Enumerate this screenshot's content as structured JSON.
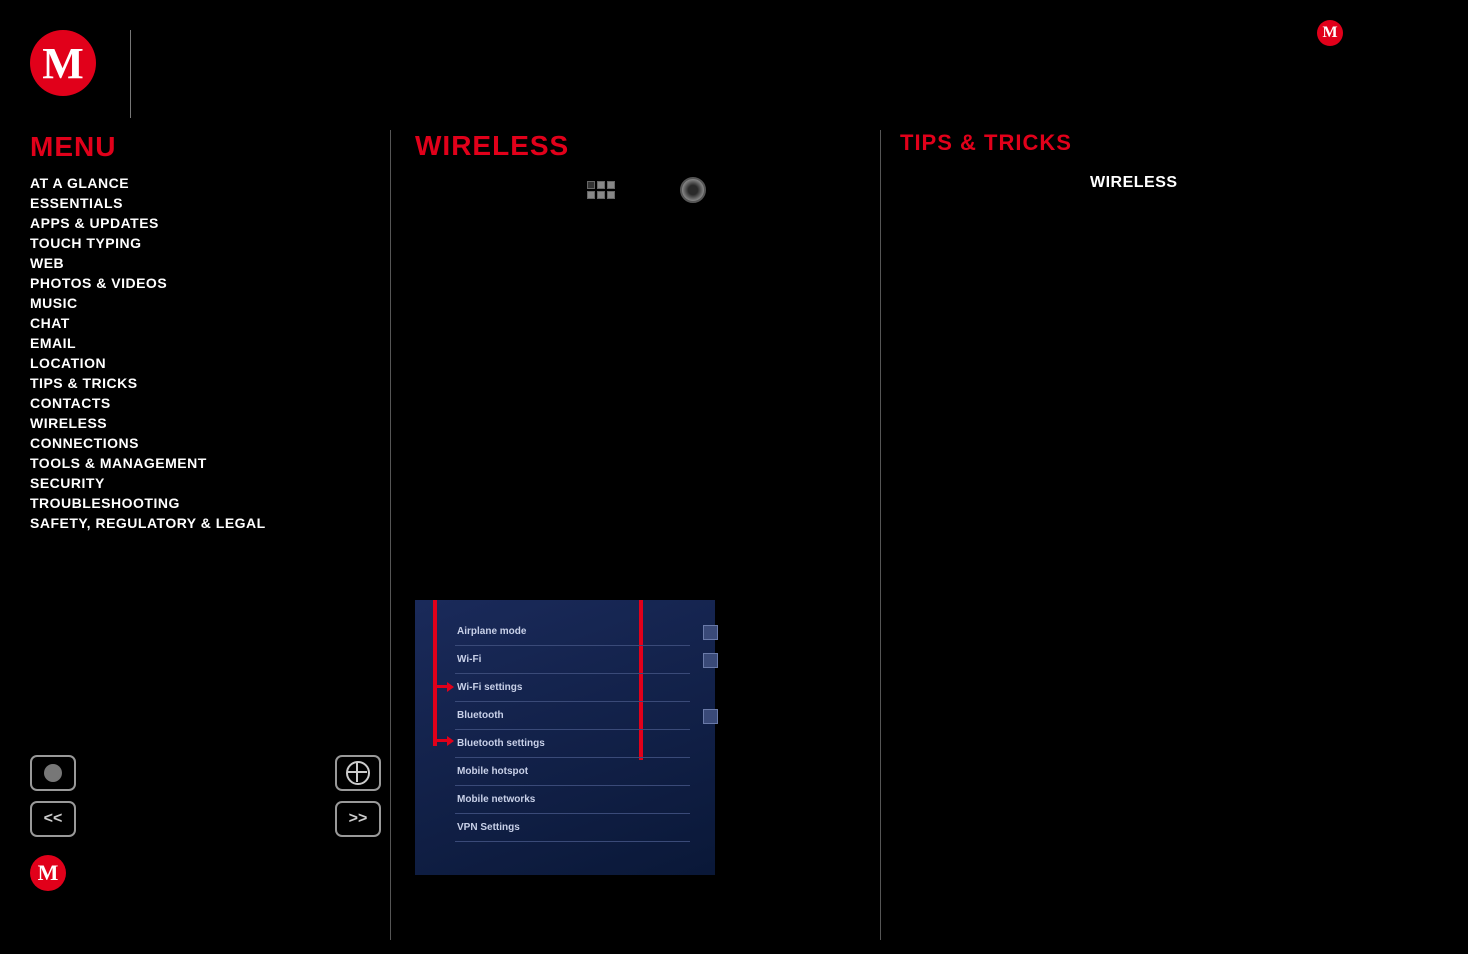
{
  "brand_letter": "M",
  "menu_title": "MENU",
  "menu_items": [
    "AT A GLANCE",
    "ESSENTIALS",
    "APPS & UPDATES",
    "TOUCH TYPING",
    "WEB",
    "PHOTOS & VIDEOS",
    "MUSIC",
    "CHAT",
    "EMAIL",
    "LOCATION",
    "TIPS & TRICKS",
    "CONTACTS",
    "WIRELESS",
    "CONNECTIONS",
    "TOOLS & MANAGEMENT",
    "SECURITY",
    "TROUBLESHOOTING",
    "SAFETY, REGULATORY & LEGAL"
  ],
  "center_title": "WIRELESS",
  "settings_items": [
    {
      "label": "Airplane mode",
      "checkbox": true
    },
    {
      "label": "Wi-Fi",
      "checkbox": true
    },
    {
      "label": "Wi-Fi settings",
      "checkbox": false
    },
    {
      "label": "Bluetooth",
      "checkbox": true
    },
    {
      "label": "Bluetooth settings",
      "checkbox": false
    },
    {
      "label": "Mobile hotspot",
      "checkbox": false
    },
    {
      "label": "Mobile networks",
      "checkbox": false
    },
    {
      "label": "VPN Settings",
      "checkbox": false
    }
  ],
  "right_title": "TIPS & TRICKS",
  "right_sub": "WIRELESS",
  "nav": {
    "back": "<<",
    "fwd": ">>"
  }
}
